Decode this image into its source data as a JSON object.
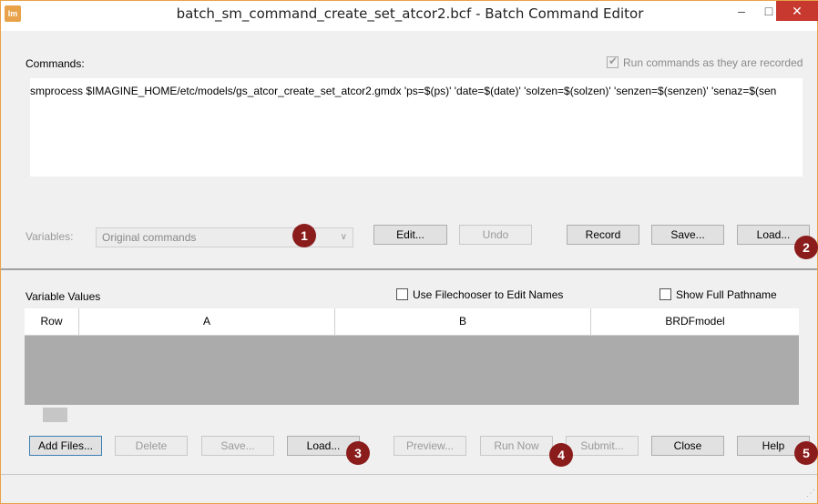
{
  "window": {
    "app_icon_text": "Im",
    "title": "batch_sm_command_create_set_atcor2.bcf - Batch Command Editor",
    "min_symbol": "–",
    "max_symbol": "□",
    "close_symbol": "✕"
  },
  "commands": {
    "label": "Commands:",
    "run_recorded_label": "Run commands as they are recorded",
    "run_recorded_checked": true,
    "text": "smprocess $IMAGINE_HOME/etc/models/gs_atcor_create_set_atcor2.gmdx 'ps=$(ps)' 'date=$(date)' 'solzen=$(solzen)' 'senzen=$(senzen)' 'senaz=$(sen"
  },
  "variables": {
    "label": "Variables:",
    "selected": "Original commands",
    "edit_label": "Edit...",
    "undo_label": "Undo",
    "record_label": "Record",
    "save_label": "Save...",
    "load_label": "Load..."
  },
  "values": {
    "label": "Variable Values",
    "filechooser_label": "Use Filechooser to Edit Names",
    "full_path_label": "Show Full Pathname",
    "columns": [
      "Row",
      "A",
      "B",
      "BRDFmodel"
    ]
  },
  "bottom_buttons": {
    "add_files": "Add Files...",
    "delete": "Delete",
    "save": "Save...",
    "load": "Load...",
    "preview": "Preview...",
    "run_now": "Run Now",
    "submit": "Submit...",
    "close": "Close",
    "help": "Help"
  },
  "badges": [
    "1",
    "2",
    "3",
    "4",
    "5"
  ],
  "colors": {
    "badge": "#8b1c1c",
    "close_button": "#c7392f",
    "window_border": "#e8a24a"
  }
}
